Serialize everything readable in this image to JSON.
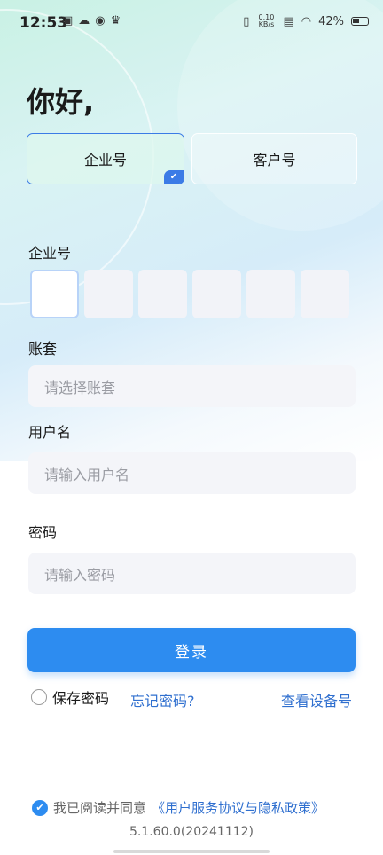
{
  "status_bar": {
    "time": "12:53",
    "net_speed_value": "0.10",
    "net_speed_unit": "KB/s",
    "battery": "42%",
    "left_icons": [
      "sim-icon",
      "cloud-icon",
      "app-badge-icon",
      "crown-icon"
    ],
    "right_icons": [
      "vibrate-icon",
      "sim-card-icon",
      "wifi-icon",
      "battery-icon"
    ]
  },
  "greeting": "你好,",
  "tabs": {
    "enterprise": "企业号",
    "customer": "客户号",
    "selected": "enterprise"
  },
  "form": {
    "enterprise_label": "企业号",
    "code_length": 6,
    "account_set_label": "账套",
    "account_set_placeholder": "请选择账套",
    "username_label": "用户名",
    "username_placeholder": "请输入用户名",
    "password_label": "密码",
    "password_placeholder": "请输入密码"
  },
  "login_button": "登录",
  "save_password": "保存密码",
  "forgot_password": "忘记密码?",
  "view_device": "查看设备号",
  "agreement": {
    "prefix": "我已阅读并同意",
    "link": "《用户服务协议与隐私政策》",
    "checked": true
  },
  "version": "5.1.60.0(20241112)",
  "colors": {
    "primary": "#2d8cf0",
    "link": "#2f6fcf",
    "selected_border": "#3b7be6"
  }
}
